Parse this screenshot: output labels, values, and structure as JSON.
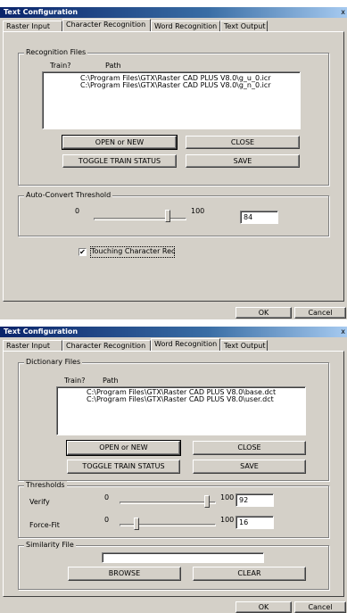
{
  "dialog1": {
    "title": "Text Configuration",
    "close_glyph": "x",
    "tabs": [
      "Raster Input",
      "Character Recognition",
      "Word Recognition",
      "Text Output"
    ],
    "active_tab": "Character Recognition",
    "recognition_files": {
      "legend": "Recognition Files",
      "col_train": "Train?",
      "col_path": "Path",
      "rows": [
        "C:\\Program Files\\GTX\\Raster CAD PLUS V8.0\\g_u_0.icr",
        "C:\\Program Files\\GTX\\Raster CAD PLUS V8.0\\g_n_0.icr"
      ],
      "buttons": {
        "open_new": "OPEN or NEW",
        "close": "CLOSE",
        "toggle_train": "TOGGLE TRAIN STATUS",
        "save": "SAVE"
      }
    },
    "auto_convert": {
      "legend": "Auto-Convert Threshold",
      "min_label": "0",
      "max_label": "100",
      "value": "84",
      "slider_fraction": 0.84
    },
    "touching_checkbox": {
      "label": "Touching Character Rec",
      "checked": true,
      "check_glyph": "✔"
    },
    "footer": {
      "ok": "OK",
      "cancel": "Cancel"
    }
  },
  "dialog2": {
    "title": "Text Configuration",
    "close_glyph": "x",
    "tabs": [
      "Raster Input",
      "Character Recognition",
      "Word Recognition",
      "Text Output"
    ],
    "active_tab": "Word Recognition",
    "dictionary_files": {
      "legend": "Dictionary Files",
      "col_train": "Train?",
      "col_path": "Path",
      "rows": [
        "C:\\Program Files\\GTX\\Raster CAD PLUS V8.0\\base.dct",
        "C:\\Program Files\\GTX\\Raster CAD PLUS V8.0\\user.dct"
      ],
      "buttons": {
        "open_new": "OPEN or NEW",
        "close": "CLOSE",
        "toggle_train": "TOGGLE TRAIN STATUS",
        "save": "SAVE"
      }
    },
    "thresholds": {
      "legend": "Thresholds",
      "verify": {
        "label": "Verify",
        "min_label": "0",
        "max_label": "100",
        "value": "92",
        "slider_fraction": 0.92
      },
      "force_fit": {
        "label": "Force-Fit",
        "min_label": "0",
        "max_label": "100",
        "value": "16",
        "slider_fraction": 0.16
      }
    },
    "similarity_file": {
      "legend": "Similarity File",
      "value": "",
      "browse": "BROWSE",
      "clear": "CLEAR"
    },
    "footer": {
      "ok": "OK",
      "cancel": "Cancel"
    }
  }
}
